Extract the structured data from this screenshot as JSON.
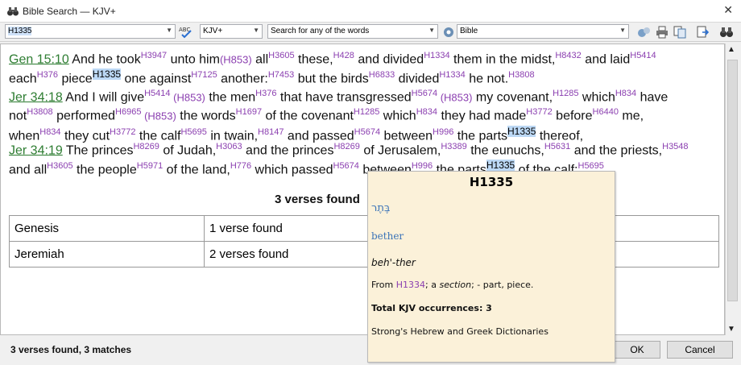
{
  "window": {
    "title": "Bible Search — KJV+"
  },
  "toolbar": {
    "search_value": "H1335",
    "version_value": "KJV+",
    "search_mode_value": "Search for any of the words",
    "scope_value": "Bible"
  },
  "verses": [
    {
      "ref": "Gen 15:10",
      "parts": [
        {
          "t": " And he took"
        },
        {
          "s": "H3947"
        },
        {
          "t": " unto him"
        },
        {
          "p": "(H853)"
        },
        {
          "t": " all"
        },
        {
          "s": "H3605"
        },
        {
          "t": " these,"
        },
        {
          "s": "H428"
        },
        {
          "t": " and divided"
        },
        {
          "s": "H1334"
        },
        {
          "t": " them in the midst,"
        },
        {
          "s": "H8432"
        },
        {
          "t": " and laid"
        },
        {
          "s": "H5414"
        },
        {
          "t": " each"
        },
        {
          "s": "H376"
        },
        {
          "t": " piece"
        },
        {
          "h": "H1335"
        },
        {
          "t": " one against"
        },
        {
          "s": "H7125"
        },
        {
          "t": " another:"
        },
        {
          "s": "H7453"
        },
        {
          "t": " but the birds"
        },
        {
          "s": "H6833"
        },
        {
          "t": " divided"
        },
        {
          "s": "H1334"
        },
        {
          "t": " he not."
        },
        {
          "s": "H3808"
        }
      ]
    },
    {
      "ref": "Jer 34:18",
      "parts": [
        {
          "t": " And I will give"
        },
        {
          "s": "H5414"
        },
        {
          "p": " (H853)"
        },
        {
          "t": " the men"
        },
        {
          "s": "H376"
        },
        {
          "t": " that have transgressed"
        },
        {
          "s": "H5674"
        },
        {
          "p": " (H853)"
        },
        {
          "t": " my covenant,"
        },
        {
          "s": "H1285"
        },
        {
          "t": " which"
        },
        {
          "s": "H834"
        },
        {
          "t": " have not"
        },
        {
          "s": "H3808"
        },
        {
          "t": " performed"
        },
        {
          "s": "H6965"
        },
        {
          "p": " (H853)"
        },
        {
          "t": " the words"
        },
        {
          "s": "H1697"
        },
        {
          "t": " of the covenant"
        },
        {
          "s": "H1285"
        },
        {
          "t": " which"
        },
        {
          "s": "H834"
        },
        {
          "t": " they had made"
        },
        {
          "s": "H3772"
        },
        {
          "t": " before"
        },
        {
          "s": "H6440"
        },
        {
          "t": " me, when"
        },
        {
          "s": "H834"
        },
        {
          "t": " they cut"
        },
        {
          "s": "H3772"
        },
        {
          "t": " the calf"
        },
        {
          "s": "H5695"
        },
        {
          "t": " in twain,"
        },
        {
          "s": "H8147"
        },
        {
          "t": " and passed"
        },
        {
          "s": "H5674"
        },
        {
          "t": " between"
        },
        {
          "s": "H996"
        },
        {
          "t": " the parts"
        },
        {
          "h": "H1335"
        },
        {
          "t": " thereof,"
        }
      ]
    },
    {
      "ref": "Jer 34:19",
      "parts": [
        {
          "t": " The princes"
        },
        {
          "s": "H8269"
        },
        {
          "t": " of Judah,"
        },
        {
          "s": "H3063"
        },
        {
          "t": " and the princes"
        },
        {
          "s": "H8269"
        },
        {
          "t": " of Jerusalem,"
        },
        {
          "s": "H3389"
        },
        {
          "t": " the eunuchs,"
        },
        {
          "s": "H5631"
        },
        {
          "t": " and the priests,"
        },
        {
          "s": "H3548"
        },
        {
          "t": " and all"
        },
        {
          "s": "H3605"
        },
        {
          "t": " the people"
        },
        {
          "s": "H5971"
        },
        {
          "t": " of the land,"
        },
        {
          "s": "H776"
        },
        {
          "t": " which passed"
        },
        {
          "s": "H5674"
        },
        {
          "t": " between"
        },
        {
          "s": "H996"
        },
        {
          "t": " the parts"
        },
        {
          "h": "H1335"
        },
        {
          "t": " of the calf;"
        },
        {
          "s": "H5695"
        }
      ]
    }
  ],
  "summary": {
    "title": "3 verses found",
    "rows": [
      {
        "book": "Genesis",
        "count": "1 verse found"
      },
      {
        "book": "Jeremiah",
        "count": "2 verses found"
      }
    ]
  },
  "status": {
    "text": "3 verses found, 3 matches"
  },
  "buttons": {
    "ok": "OK",
    "cancel": "Cancel"
  },
  "popup": {
    "title": "H1335",
    "hebrew": "בֶּתֶר",
    "translit": "bether",
    "pronunciation": "beh'-ther",
    "def_from": "From ",
    "def_link": "H1334",
    "def_mid": "; a ",
    "def_italic": "section",
    "def_rest": "; - part, piece.",
    "occurrences": "Total KJV occurrences: 3",
    "source": "Strong's Hebrew and Greek Dictionaries"
  },
  "colors": {
    "strongs": "#8b3fb0",
    "highlight": "#bcd8f5",
    "verse_ref": "#2e7d32",
    "popup_bg": "#fbf1d9"
  }
}
